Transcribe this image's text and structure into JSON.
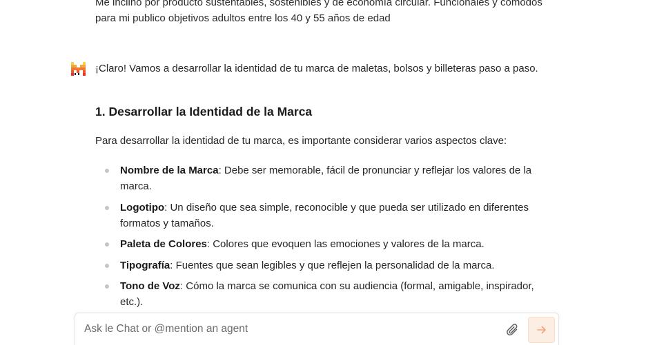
{
  "user_message": {
    "line1": "Me inclino por producto sustentables, sostenibles y de economía circular. Funcionales y cómodos",
    "line2": "para mi publico objetivos adultos entre los 40 y 55 años de edad"
  },
  "assistant": {
    "avatar_icon": "mistral-logo-icon",
    "intro": "¡Claro! Vamos a desarrollar la identidad de tu marca de maletas, bolsos y billeteras paso a paso.",
    "heading": "1. Desarrollar la Identidad de la Marca",
    "paragraph": "Para desarrollar la identidad de tu marca, es importante considerar varios aspectos clave:",
    "bullets": [
      {
        "term": "Nombre de la Marca",
        "text": ": Debe ser memorable, fácil de pronunciar y reflejar los valores de la marca."
      },
      {
        "term": "Logotipo",
        "text": ": Un diseño que sea simple, reconocible y que pueda ser utilizado en diferentes formatos y tamaños."
      },
      {
        "term": "Paleta de Colores",
        "text": ": Colores que evoquen las emociones y valores de la marca."
      },
      {
        "term": "Tipografía",
        "text": ": Fuentes que sean legibles y que reflejen la personalidad de la marca."
      },
      {
        "term": "Tono de Voz",
        "text": ": Cómo la marca se comunica con su audiencia (formal, amigable, inspirador, etc.)."
      }
    ]
  },
  "chat_input": {
    "placeholder": "Ask le Chat or @mention an agent",
    "attach_icon": "paperclip-icon",
    "send_icon": "arrow-right-icon"
  },
  "colors": {
    "send_bg": "#fdeee3",
    "send_arrow": "#f4a37a",
    "logo_orange": "#f7a21b",
    "logo_red": "#e8401c"
  }
}
